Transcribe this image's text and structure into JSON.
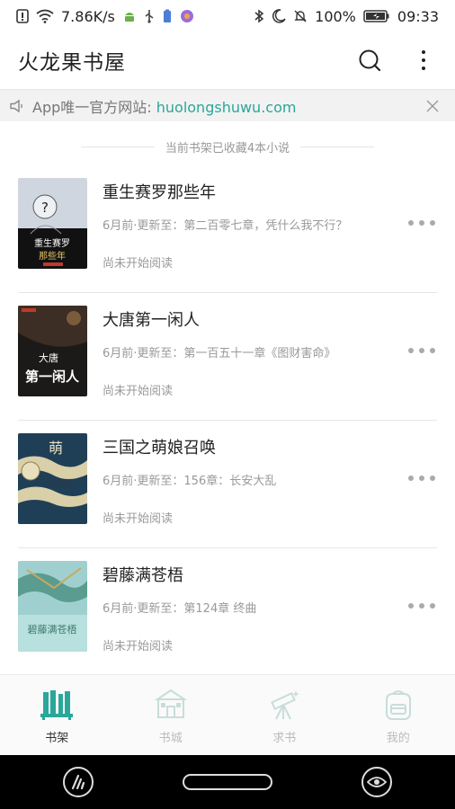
{
  "status_bar": {
    "net_speed": "7.86K/s",
    "battery": "100%",
    "time": "09:33"
  },
  "app_bar": {
    "title": "火龙果书屋",
    "icons": [
      "search-icon",
      "more-vert-icon"
    ]
  },
  "notice": {
    "prefix": "App唯一官方网站: ",
    "link": "huolongshuwu.com",
    "icons": [
      "speaker-icon",
      "close-icon"
    ]
  },
  "shelf_count": "当前书架已收藏4本小说",
  "books": [
    {
      "title": "重生赛罗那些年",
      "update": "6月前·更新至：第二百零七章，凭什么我不行？",
      "status": "尚未开始阅读",
      "cover_text": [
        "重生赛罗",
        "那些年"
      ]
    },
    {
      "title": "大唐第一闲人",
      "update": "6月前·更新至：第一百五十一章《图财害命》",
      "status": "尚未开始阅读",
      "cover_text": [
        "大唐",
        "第一闲人"
      ]
    },
    {
      "title": "三国之萌娘召唤",
      "update": "6月前·更新至：156章：长安大乱",
      "status": "尚未开始阅读",
      "cover_text": [
        "萌",
        "娘召唤"
      ]
    },
    {
      "title": "碧藤满苍梧",
      "update": "6月前·更新至：第124章 终曲",
      "status": "尚未开始阅读",
      "cover_text": [
        "碧藤满苍梧"
      ]
    }
  ],
  "bottom_nav": [
    {
      "label": "书架",
      "icon": "bookshelf-icon",
      "active": true
    },
    {
      "label": "书城",
      "icon": "store-icon",
      "active": false
    },
    {
      "label": "求书",
      "icon": "telescope-icon",
      "active": false
    },
    {
      "label": "我的",
      "icon": "backpack-icon",
      "active": false
    }
  ],
  "colors": {
    "accent": "#2aa79b",
    "nav_active": "#2aa79b",
    "nav_inactive": "#c8ddd9"
  }
}
